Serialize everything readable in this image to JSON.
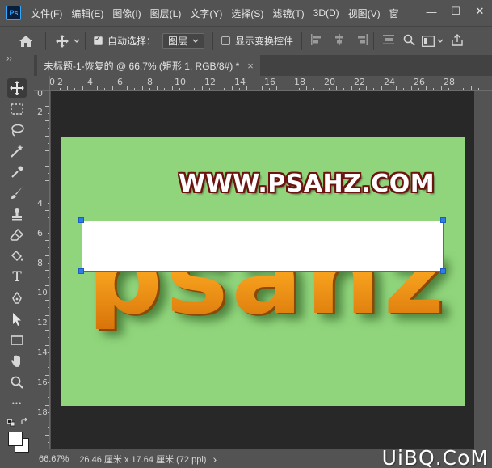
{
  "app": {
    "logo": "Ps"
  },
  "menu": [
    "文件(F)",
    "编辑(E)",
    "图像(I)",
    "图层(L)",
    "文字(Y)",
    "选择(S)",
    "滤镜(T)",
    "3D(D)",
    "视图(V)",
    "窗"
  ],
  "window_controls": {
    "minimize": "—",
    "maximize": "☐",
    "close": "✕"
  },
  "options": {
    "auto_select_label": "自动选择：",
    "auto_select_checked": true,
    "auto_select_target": "图层",
    "show_transform_label": "显示变换控件",
    "show_transform_checked": false
  },
  "tab": {
    "title": "未标题-1-恢复的 @ 66.7% (矩形 1, RGB/8#) *",
    "close": "×"
  },
  "ruler": {
    "top": [
      "2",
      "0",
      "2",
      "4",
      "6",
      "8",
      "10",
      "12",
      "14",
      "16",
      "18",
      "20",
      "22",
      "24",
      "26",
      "28"
    ],
    "left": [
      "0",
      "2",
      "4",
      "6",
      "8",
      "10",
      "12",
      "14",
      "16",
      "18"
    ]
  },
  "canvas": {
    "background": "#90d57c",
    "top_text": "WWW.PSAHZ.COM",
    "big_text": "psahz"
  },
  "status": {
    "zoom": "66.67%",
    "doc_size": "26.46 厘米 x 17.64 厘米 (72 ppi)",
    "arrow": "›"
  },
  "brand": "UiBQ.CoM",
  "toolbar": {
    "collapse": "››",
    "tools": [
      "move-tool",
      "marquee-tool",
      "lasso-tool",
      "magic-wand-tool",
      "eyedropper-tool",
      "brush-tool",
      "stamp-tool",
      "eraser-tool",
      "fill-tool",
      "type-tool",
      "pen-tool",
      "path-select-tool",
      "rectangle-tool",
      "hand-tool",
      "zoom-tool",
      "more-tools"
    ],
    "type_glyph": "T",
    "more_glyph": "•••"
  }
}
